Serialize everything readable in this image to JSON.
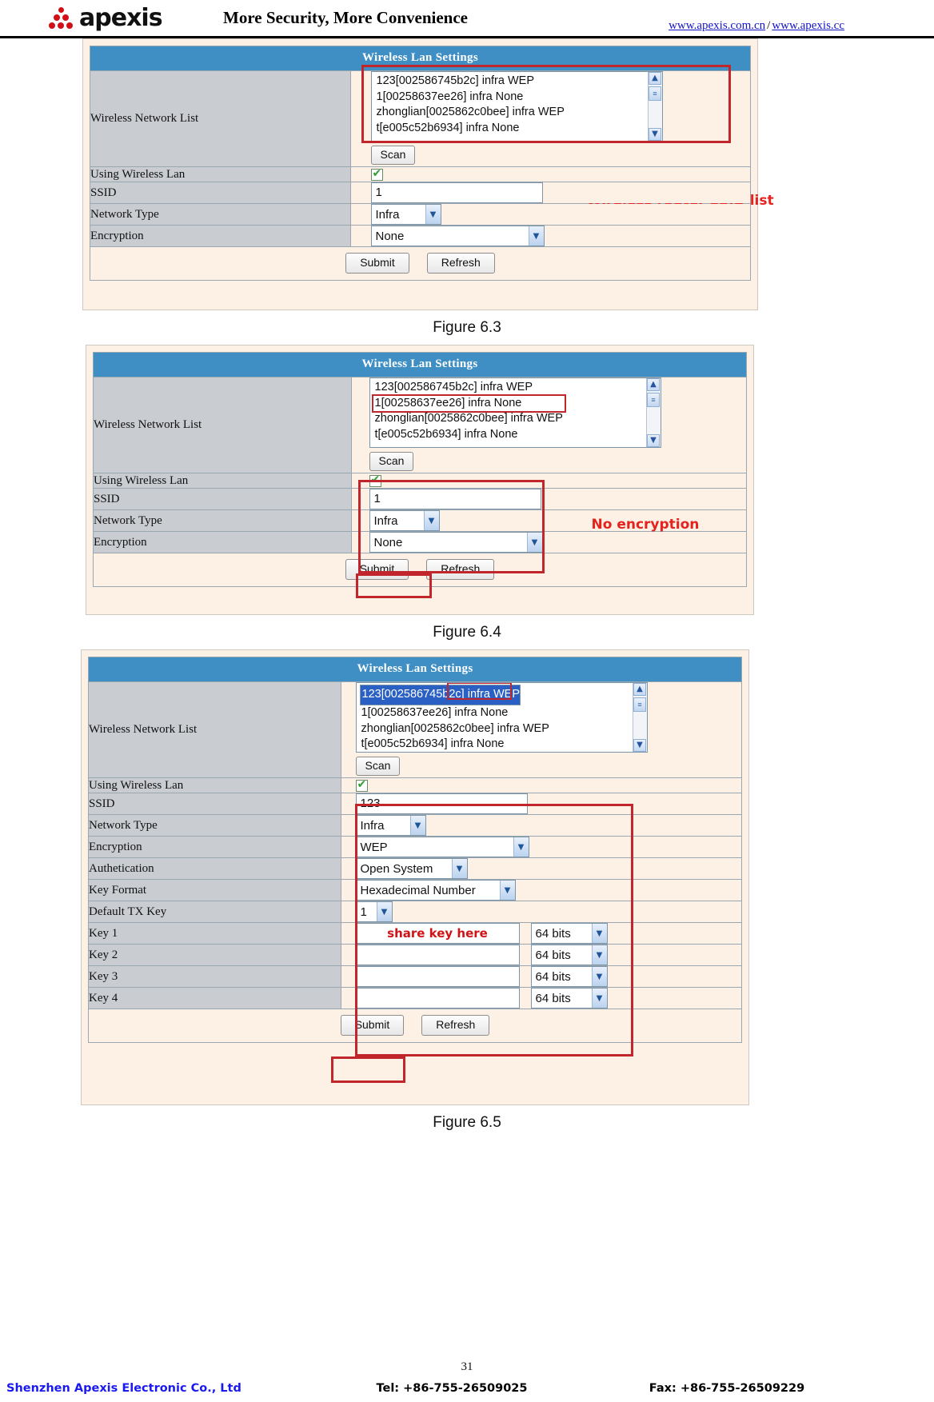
{
  "header": {
    "logo_text": "apexis",
    "tagline": "More Security, More Convenience",
    "url1": "www.apexis.com.cn",
    "url_separator": "/",
    "url2": "www.apexis.cc"
  },
  "common": {
    "panel_title": "Wireless Lan Settings",
    "label_network_list": "Wireless Network List",
    "label_using_wireless": "Using Wireless Lan",
    "label_ssid": "SSID",
    "label_network_type": "Network Type",
    "label_encryption": "Encryption",
    "label_authentication": "Authetication",
    "label_key_format": "Key Format",
    "label_default_tx_key": "Default TX Key",
    "label_key1": "Key 1",
    "label_key2": "Key 2",
    "label_key3": "Key 3",
    "label_key4": "Key 4",
    "scan_button": "Scan",
    "submit_button": "Submit",
    "refresh_button": "Refresh",
    "network_items": [
      "123[002586745b2c] infra WEP",
      "1[00258637ee26] infra None",
      "zhonglian[0025862c0bee] infra WEP",
      "t[e005c52b6934] infra None"
    ],
    "scroll_up": "▲",
    "scroll_down": "▼",
    "scroll_thumb": "≡",
    "dropdown_arrow": "▼"
  },
  "figure63": {
    "caption": "Figure 6.3",
    "ssid_value": "1",
    "network_type_value": "Infra",
    "encryption_value": "None",
    "annotation": "Wireless router SSID list"
  },
  "figure64": {
    "caption": "Figure 6.4",
    "ssid_value": "1",
    "network_type_value": "Infra",
    "encryption_value": "None",
    "annotation": "No encryption",
    "highlighted_item_index": 1
  },
  "figure65": {
    "caption": "Figure 6.5",
    "ssid_value": "123",
    "network_type_value": "Infra",
    "encryption_value": "WEP",
    "authentication_value": "Open System",
    "key_format_value": "Hexadecimal Number",
    "default_tx_key_value": "1",
    "key1_value": "share key here",
    "key2_value": "",
    "key3_value": "",
    "key4_value": "",
    "key1_bits": "64 bits",
    "key2_bits": "64 bits",
    "key3_bits": "64 bits",
    "key4_bits": "64 bits",
    "selected_item_index": 0
  },
  "footer": {
    "page_number": "31",
    "company": "Shenzhen Apexis Electronic Co., Ltd",
    "tel": "Tel: +86-755-26509025",
    "fax": "Fax: +86-755-26509229"
  }
}
